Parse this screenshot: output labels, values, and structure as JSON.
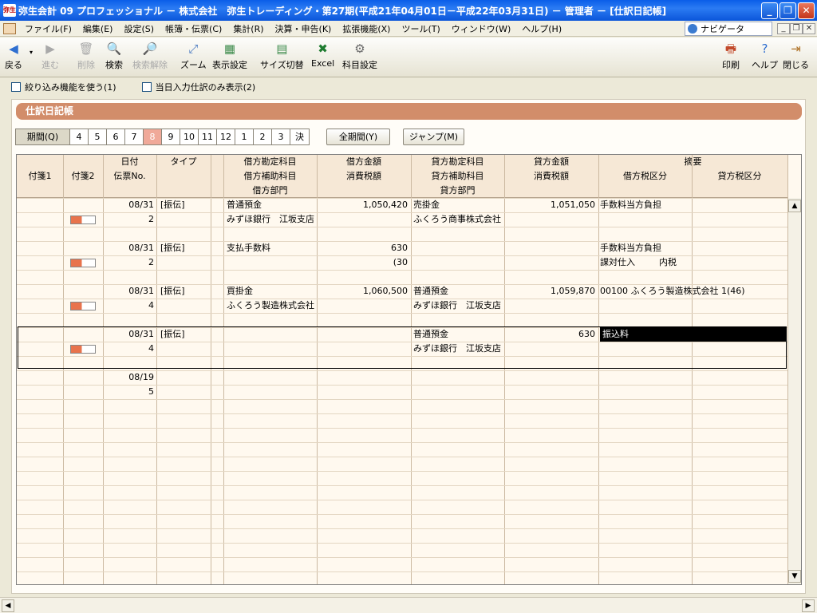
{
  "window": {
    "title": "弥生会計 09 プロフェッショナル － 株式会社　弥生トレーディング・第27期(平成21年04月01日－平成22年03月31日) － 管理者 － [仕訳日記帳]",
    "app_icon_text": "弥生"
  },
  "menu": [
    "ファイル(F)",
    "編集(E)",
    "設定(S)",
    "帳簿・伝票(C)",
    "集計(R)",
    "決算・申告(K)",
    "拡張機能(X)",
    "ツール(T)",
    "ウィンドウ(W)",
    "ヘルプ(H)"
  ],
  "navigator": "ナビゲータ",
  "toolbar": {
    "back": "戻る",
    "forward": "進む",
    "delete": "削除",
    "search": "検索",
    "clear_search": "検索解除",
    "zoom": "ズーム",
    "display_settings": "表示設定",
    "size_toggle": "サイズ切替",
    "excel": "Excel",
    "account_settings": "科目設定",
    "print": "印刷",
    "help": "ヘルプ",
    "close": "閉じる"
  },
  "options": {
    "filter": "絞り込み機能を使う(1)",
    "today_only": "当日入力仕訳のみ表示(2)"
  },
  "section_title": "仕訳日記帳",
  "periods": {
    "label": "期間(Q)",
    "items": [
      "4",
      "5",
      "6",
      "7",
      "8",
      "9",
      "10",
      "11",
      "12",
      "1",
      "2",
      "3",
      "決"
    ],
    "selected": "8"
  },
  "buttons": {
    "all_periods": "全期間(Y)",
    "jump": "ジャンプ(M)"
  },
  "headers": {
    "tag1": "付箋1",
    "tag2": "付箋2",
    "date": "日付",
    "slip": "伝票No.",
    "type": "タイプ",
    "debit_account": "借方勘定科目",
    "debit_sub": "借方補助科目",
    "debit_dept": "借方部門",
    "debit_amount": "借方金額",
    "debit_tax": "消費税額",
    "credit_account": "貸方勘定科目",
    "credit_sub": "貸方補助科目",
    "credit_dept": "貸方部門",
    "credit_amount": "貸方金額",
    "credit_tax": "消費税額",
    "memo": "摘要",
    "debit_taxcat": "借方税区分",
    "credit_taxcat": "貸方税区分"
  },
  "entries": [
    {
      "date": "08/31",
      "slip": "2",
      "type": "[振伝]",
      "debit_account": "普通預金",
      "debit_sub": "みずほ銀行　江坂支店",
      "debit_amount": "1,050,420",
      "debit_tax": "",
      "credit_account": "売掛金",
      "credit_sub": "ふくろう商事株式会社",
      "credit_amount": "1,051,050",
      "credit_tax": "",
      "memo": "手数料当方負担",
      "taxcat1": "",
      "taxcat2": ""
    },
    {
      "date": "08/31",
      "slip": "2",
      "type": "[振伝]",
      "debit_account": "支払手数料",
      "debit_sub": "",
      "debit_amount": "630",
      "debit_tax": "(30",
      "credit_account": "",
      "credit_sub": "",
      "credit_amount": "",
      "credit_tax": "",
      "memo": "手数料当方負担",
      "taxcat1": "課対仕入",
      "taxcat2": "内税"
    },
    {
      "date": "08/31",
      "slip": "4",
      "type": "[振伝]",
      "debit_account": "買掛金",
      "debit_sub": "ふくろう製造株式会社",
      "debit_amount": "1,060,500",
      "debit_tax": "",
      "credit_account": "普通預金",
      "credit_sub": "みずほ銀行　江坂支店",
      "credit_amount": "1,059,870",
      "credit_tax": "",
      "memo": "00100 ふくろう製造株式会社 1(46)",
      "taxcat1": "",
      "taxcat2": ""
    },
    {
      "date": "08/31",
      "slip": "4",
      "type": "[振伝]",
      "debit_account": "",
      "debit_sub": "",
      "debit_amount": "",
      "debit_tax": "",
      "credit_account": "普通預金",
      "credit_sub": "みずほ銀行　江坂支店",
      "credit_amount": "630",
      "credit_tax": "",
      "memo": "振込料",
      "taxcat1": "",
      "taxcat2": ""
    },
    {
      "date": "08/19",
      "slip": "5",
      "type": "",
      "debit_account": "",
      "debit_sub": "",
      "debit_amount": "",
      "debit_tax": "",
      "credit_account": "",
      "credit_sub": "",
      "credit_amount": "",
      "credit_tax": "",
      "memo": "",
      "taxcat1": "",
      "taxcat2": ""
    }
  ]
}
